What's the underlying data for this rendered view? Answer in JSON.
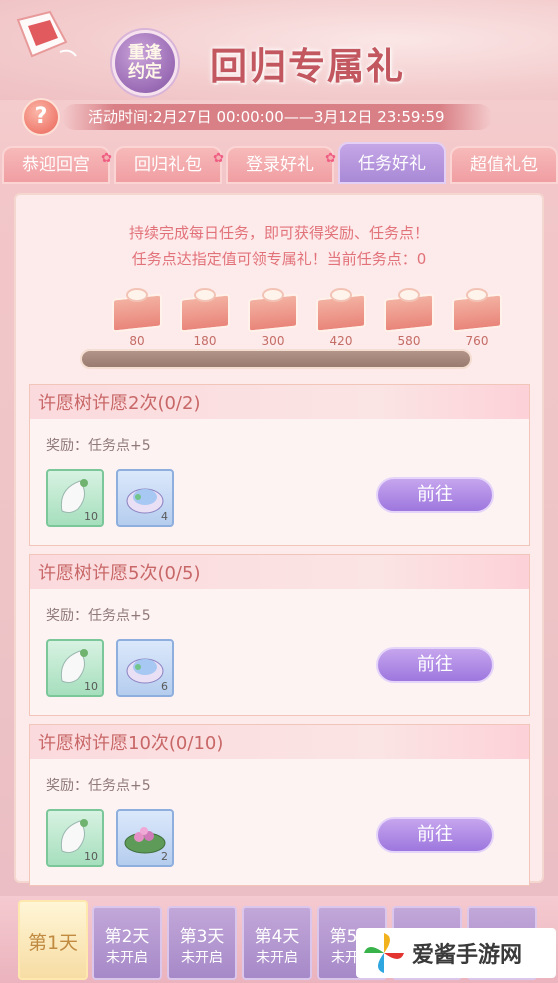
{
  "header": {
    "seal_text": "重逢约定",
    "title": "回归专属礼",
    "help_icon_text": "?",
    "event_time": "活动时间:2月27日 00:00:00——3月12日 23:59:59"
  },
  "tabs": [
    {
      "label": "恭迎回宫",
      "active": false
    },
    {
      "label": "回归礼包",
      "active": false
    },
    {
      "label": "登录好礼",
      "active": false
    },
    {
      "label": "任务好礼",
      "active": true
    },
    {
      "label": "超值礼包",
      "active": false
    }
  ],
  "intro": {
    "line1": "持续完成每日任务，即可获得奖励、任务点！",
    "line2": "任务点达指定值可领专属礼！当前任务点：0"
  },
  "milestones": [
    "80",
    "180",
    "300",
    "420",
    "580",
    "760"
  ],
  "progress": {
    "current": 0,
    "max": 760
  },
  "tasks": [
    {
      "title": "许愿树许愿2次(0/2)",
      "reward": "奖励：任务点+5",
      "items": [
        {
          "icon": "white-leaf-item-icon",
          "count": "10",
          "style": "green"
        },
        {
          "icon": "compact-mirror-item-icon",
          "count": "4",
          "style": "blue"
        }
      ],
      "button": "前往"
    },
    {
      "title": "许愿树许愿5次(0/5)",
      "reward": "奖励：任务点+5",
      "items": [
        {
          "icon": "white-leaf-item-icon",
          "count": "10",
          "style": "green"
        },
        {
          "icon": "compact-mirror-item-icon",
          "count": "6",
          "style": "blue"
        }
      ],
      "button": "前往"
    },
    {
      "title": "许愿树许愿10次(0/10)",
      "reward": "奖励：任务点+5",
      "items": [
        {
          "icon": "white-leaf-item-icon",
          "count": "10",
          "style": "green"
        },
        {
          "icon": "lotus-leaf-item-icon",
          "count": "2",
          "style": "blue"
        }
      ],
      "button": "前往"
    }
  ],
  "days": [
    {
      "label": "第1天",
      "status": "",
      "active": true
    },
    {
      "label": "第2天",
      "status": "未开启",
      "active": false
    },
    {
      "label": "第3天",
      "status": "未开启",
      "active": false
    },
    {
      "label": "第4天",
      "status": "未开启",
      "active": false
    },
    {
      "label": "第5天",
      "status": "未开启",
      "active": false
    }
  ],
  "watermark": {
    "text": "爱酱手游网"
  },
  "colors": {
    "accent_red": "#c2575f",
    "accent_purple": "#a889d6",
    "text_pink": "#e2727a"
  }
}
